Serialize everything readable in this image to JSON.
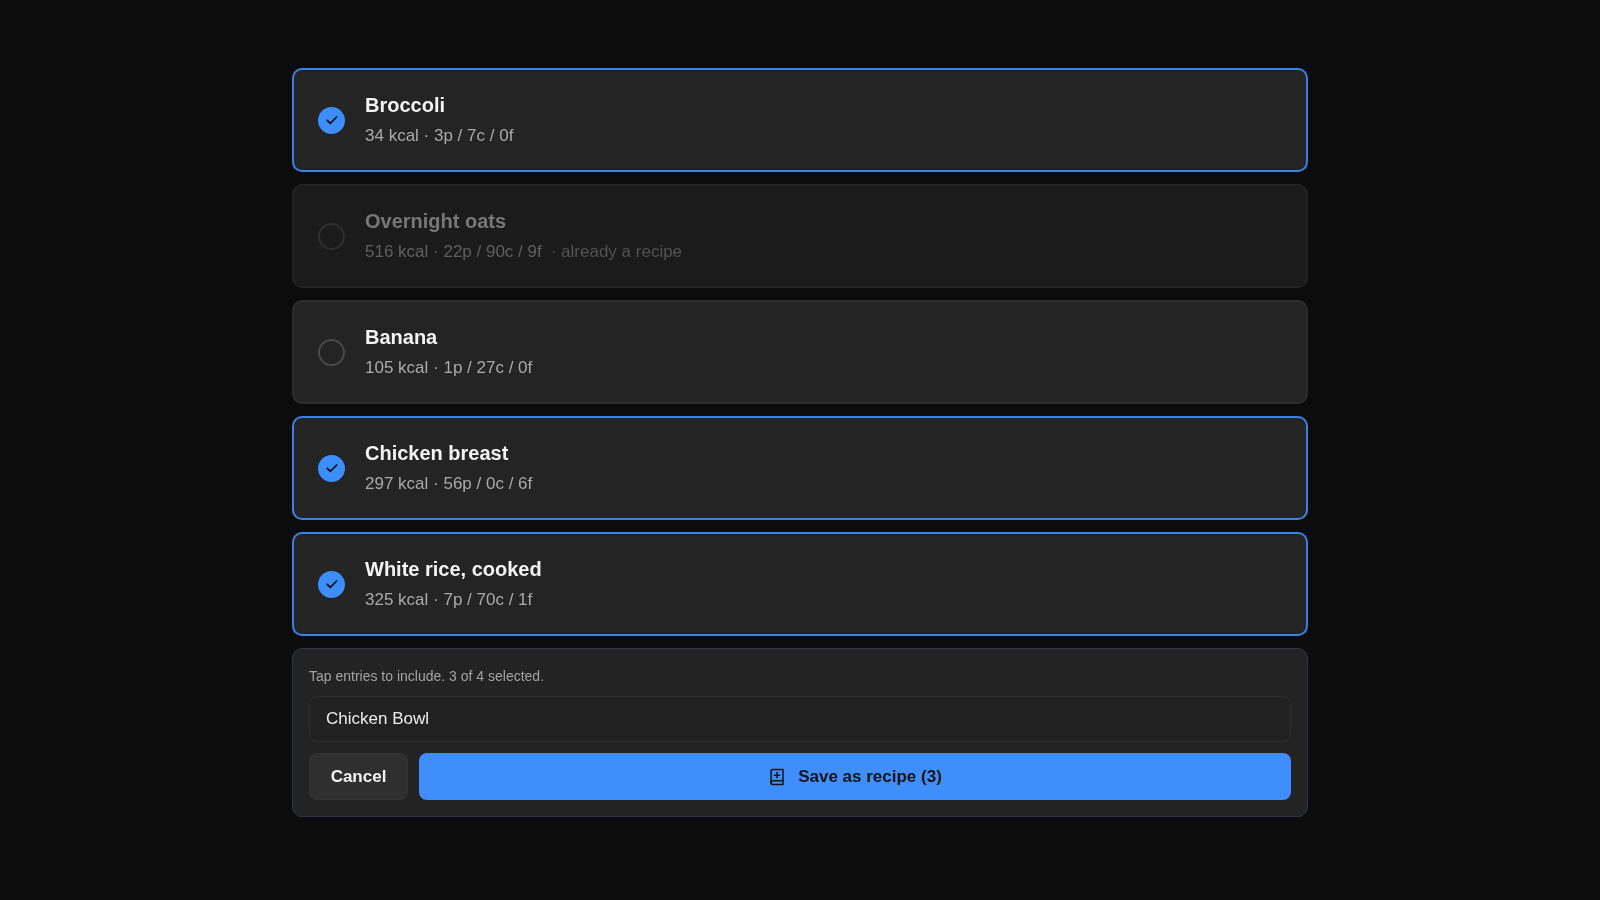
{
  "entries": [
    {
      "name": "Broccoli",
      "macros": "34 kcal · 3p / 7c / 0f",
      "selected": true,
      "disabled": false
    },
    {
      "name": "Overnight oats",
      "macros": "516 kcal · 22p / 90c / 9f",
      "note": "· already a recipe",
      "selected": false,
      "disabled": true
    },
    {
      "name": "Banana",
      "macros": "105 kcal · 1p / 27c / 0f",
      "selected": false,
      "disabled": false
    },
    {
      "name": "Chicken breast",
      "macros": "297 kcal · 56p / 0c / 6f",
      "selected": true,
      "disabled": false
    },
    {
      "name": "White rice, cooked",
      "macros": "325 kcal · 7p / 70c / 1f",
      "selected": true,
      "disabled": false
    }
  ],
  "footer": {
    "hint": "Tap entries to include. 3 of 4 selected.",
    "recipe_name": {
      "value": "Chicken Bowl"
    },
    "buttons": [
      {
        "kind": "cancel",
        "label": "Cancel"
      },
      {
        "kind": "save",
        "label": "Save as recipe (3)"
      }
    ]
  }
}
